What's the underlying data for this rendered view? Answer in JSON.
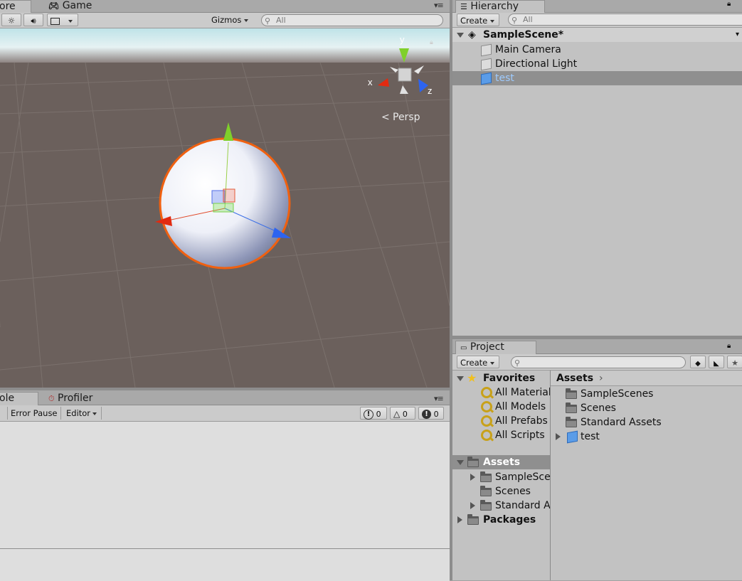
{
  "scene_tabs": {
    "scene_partial": "ore",
    "game": "Game"
  },
  "scene_toolbar": {
    "gizmos": "Gizmos",
    "search_placeholder": "All"
  },
  "viewport": {
    "axis_x": "x",
    "axis_y": "y",
    "axis_z": "z",
    "projection": "Persp",
    "sky_color": "#d8ecee",
    "ground_color": "#6b605c",
    "selection_outline": "#f06010"
  },
  "hierarchy": {
    "tab": "Hierarchy",
    "create": "Create",
    "search_placeholder": "All",
    "scene_name": "SampleScene*",
    "items": [
      "Main Camera",
      "Directional Light",
      "test"
    ]
  },
  "console": {
    "tab_partial": "ole",
    "profiler_tab": "Profiler",
    "error_pause": "Error Pause",
    "editor": "Editor",
    "info_count": "0",
    "warn_count": "0",
    "error_count": "0"
  },
  "project": {
    "tab": "Project",
    "create": "Create",
    "favorites_label": "Favorites",
    "favorites": [
      "All Materials",
      "All Models",
      "All Prefabs",
      "All Scripts"
    ],
    "assets_label": "Assets",
    "assets_tree": [
      "SampleScenes",
      "Scenes",
      "Standard Assets"
    ],
    "packages_label": "Packages",
    "breadcrumb": "Assets",
    "grid_items": [
      "SampleScenes",
      "Scenes",
      "Standard Assets",
      "test"
    ]
  }
}
